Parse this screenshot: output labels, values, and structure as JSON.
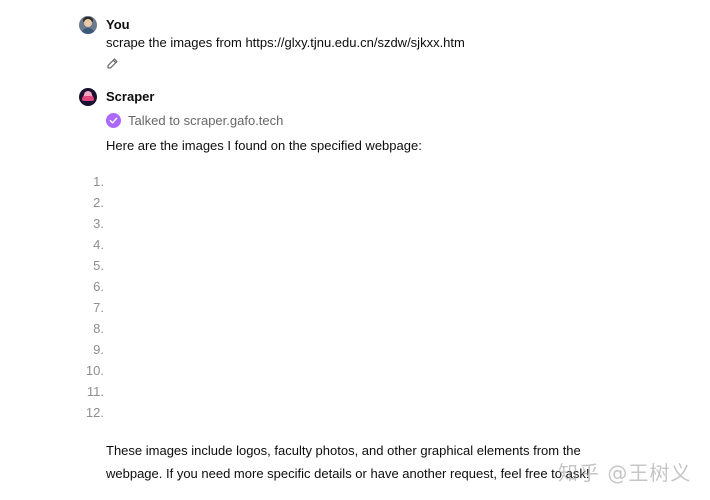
{
  "user": {
    "name": "You",
    "message": "scrape the images from https://glxy.tjnu.edu.cn/szdw/sjkxx.htm",
    "avatar_icon": "user-photo-icon",
    "edit_icon": "pencil-icon"
  },
  "assistant": {
    "name": "Scraper",
    "avatar_icon": "scraper-logo-icon",
    "tool_call": {
      "icon": "check-circle-icon",
      "icon_color": "#ab68ff",
      "text": "Talked to scraper.gafo.tech"
    },
    "intro": "Here are the images I found on the specified webpage:",
    "list": [
      "1.",
      "2.",
      "3.",
      "4.",
      "5.",
      "6.",
      "7.",
      "8.",
      "9.",
      "10.",
      "11.",
      "12."
    ],
    "outro": "These images include logos, faculty photos, and other graphical elements from the webpage. If you need more specific details or have another request, feel free to ask!"
  },
  "watermark": "知乎 @王树义"
}
